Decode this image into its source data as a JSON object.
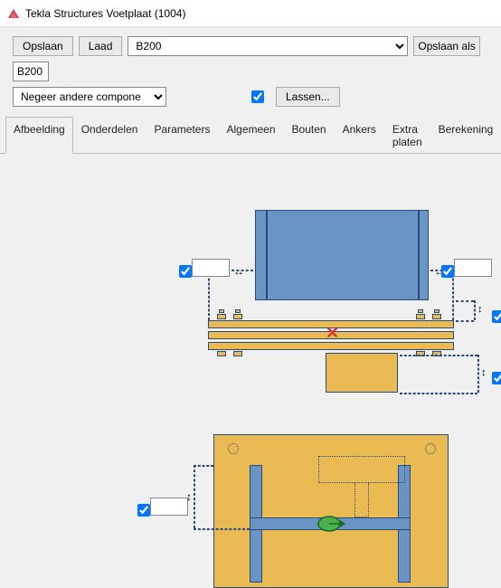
{
  "window": {
    "title": "Tekla Structures  Voetplaat (1004)"
  },
  "toolbar": {
    "save_label": "Opslaan",
    "load_label": "Laad",
    "combo_value": "B200",
    "save_as_label": "Opslaan als",
    "save_as_value": "B200"
  },
  "toolbar2": {
    "ignore_combo_value": "Negeer andere compone",
    "welds_checked": true,
    "welds_button_label": "Lassen..."
  },
  "tabs": {
    "items": [
      {
        "label": "Afbeelding",
        "active": true
      },
      {
        "label": "Onderdelen"
      },
      {
        "label": "Parameters"
      },
      {
        "label": "Algemeen"
      },
      {
        "label": "Bouten"
      },
      {
        "label": "Ankers"
      },
      {
        "label": "Extra platen"
      },
      {
        "label": "Berekening"
      }
    ]
  },
  "icons": {
    "app_logo": "tekla-logo"
  }
}
